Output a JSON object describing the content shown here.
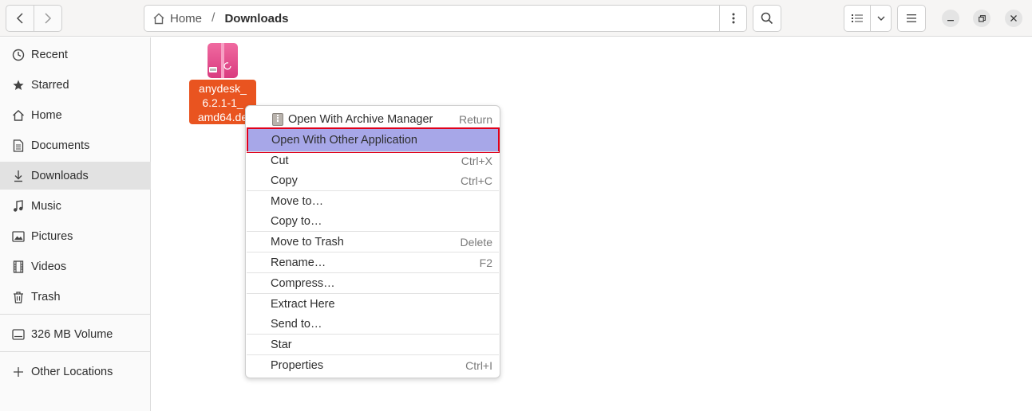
{
  "pathbar": {
    "home_label": "Home",
    "separator": "/",
    "current": "Downloads"
  },
  "sidebar": {
    "items": [
      {
        "label": "Recent",
        "icon": "clock-icon"
      },
      {
        "label": "Starred",
        "icon": "star-icon"
      },
      {
        "label": "Home",
        "icon": "home-icon"
      },
      {
        "label": "Documents",
        "icon": "document-icon"
      },
      {
        "label": "Downloads",
        "icon": "download-icon"
      },
      {
        "label": "Music",
        "icon": "music-icon"
      },
      {
        "label": "Pictures",
        "icon": "picture-icon"
      },
      {
        "label": "Videos",
        "icon": "video-icon"
      },
      {
        "label": "Trash",
        "icon": "trash-icon"
      },
      {
        "label": "326 MB Volume",
        "icon": "drive-icon"
      },
      {
        "label": "Other Locations",
        "icon": "plus-icon"
      }
    ]
  },
  "file": {
    "name_line1": "anydesk_",
    "name_line2": "6.2.1-1_",
    "name_line3": "amd64.de"
  },
  "context_menu": {
    "items": [
      {
        "label": "Open With Archive Manager",
        "accel": "Return"
      },
      {
        "label": "Open With Other Application",
        "accel": ""
      },
      {
        "label": "Cut",
        "accel": "Ctrl+X"
      },
      {
        "label": "Copy",
        "accel": "Ctrl+C"
      },
      {
        "label": "Move to…",
        "accel": ""
      },
      {
        "label": "Copy to…",
        "accel": ""
      },
      {
        "label": "Move to Trash",
        "accel": "Delete"
      },
      {
        "label": "Rename…",
        "accel": "F2"
      },
      {
        "label": "Compress…",
        "accel": ""
      },
      {
        "label": "Extract Here",
        "accel": ""
      },
      {
        "label": "Send to…",
        "accel": ""
      },
      {
        "label": "Star",
        "accel": ""
      },
      {
        "label": "Properties",
        "accel": "Ctrl+I"
      }
    ]
  },
  "colors": {
    "accent": "#e95420",
    "highlight": "#a7a7e8",
    "highlight_outline": "#e0001b"
  }
}
